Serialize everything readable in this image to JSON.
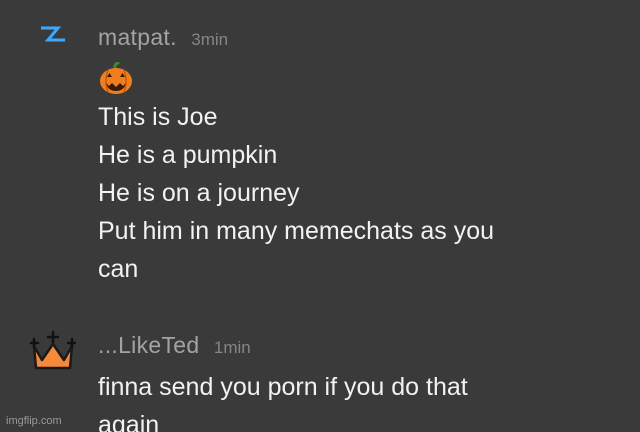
{
  "messages": [
    {
      "username": "matpat.",
      "timestamp": "3min",
      "avatar_icon": "lightning-icon",
      "emoji": "jack-o-lantern-emoji",
      "lines": [
        "This is Joe",
        "He is a pumpkin",
        "He is on a journey",
        "Put him in many memechats as you",
        "can"
      ]
    },
    {
      "username": "...LikeTed",
      "timestamp": "1min",
      "avatar_icon": "crown-icon",
      "lines": [
        "finna send you porn if you do that",
        "again"
      ]
    }
  ],
  "watermark": "imgflip.com",
  "colors": {
    "background": "#3a3a3b",
    "username": "#a3a3a6",
    "timestamp": "#85858a",
    "text": "#f2f2f2",
    "lightning": "#3aa8ff",
    "pumpkin": "#f07d1e",
    "crown": "#f58a3a"
  }
}
